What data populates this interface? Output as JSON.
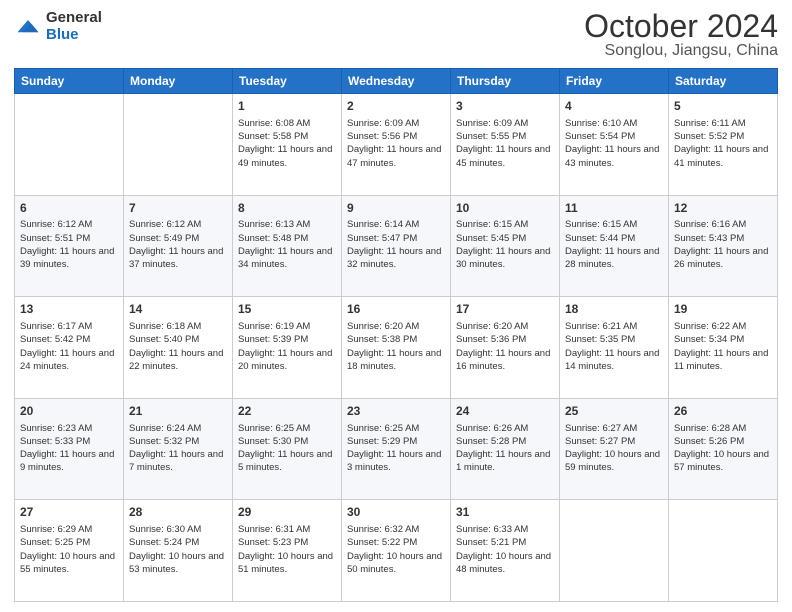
{
  "header": {
    "logo_general": "General",
    "logo_blue": "Blue",
    "month_title": "October 2024",
    "location": "Songlou, Jiangsu, China"
  },
  "weekdays": [
    "Sunday",
    "Monday",
    "Tuesday",
    "Wednesday",
    "Thursday",
    "Friday",
    "Saturday"
  ],
  "weeks": [
    [
      {
        "day": "",
        "sunrise": "",
        "sunset": "",
        "daylight": ""
      },
      {
        "day": "",
        "sunrise": "",
        "sunset": "",
        "daylight": ""
      },
      {
        "day": "1",
        "sunrise": "Sunrise: 6:08 AM",
        "sunset": "Sunset: 5:58 PM",
        "daylight": "Daylight: 11 hours and 49 minutes."
      },
      {
        "day": "2",
        "sunrise": "Sunrise: 6:09 AM",
        "sunset": "Sunset: 5:56 PM",
        "daylight": "Daylight: 11 hours and 47 minutes."
      },
      {
        "day": "3",
        "sunrise": "Sunrise: 6:09 AM",
        "sunset": "Sunset: 5:55 PM",
        "daylight": "Daylight: 11 hours and 45 minutes."
      },
      {
        "day": "4",
        "sunrise": "Sunrise: 6:10 AM",
        "sunset": "Sunset: 5:54 PM",
        "daylight": "Daylight: 11 hours and 43 minutes."
      },
      {
        "day": "5",
        "sunrise": "Sunrise: 6:11 AM",
        "sunset": "Sunset: 5:52 PM",
        "daylight": "Daylight: 11 hours and 41 minutes."
      }
    ],
    [
      {
        "day": "6",
        "sunrise": "Sunrise: 6:12 AM",
        "sunset": "Sunset: 5:51 PM",
        "daylight": "Daylight: 11 hours and 39 minutes."
      },
      {
        "day": "7",
        "sunrise": "Sunrise: 6:12 AM",
        "sunset": "Sunset: 5:49 PM",
        "daylight": "Daylight: 11 hours and 37 minutes."
      },
      {
        "day": "8",
        "sunrise": "Sunrise: 6:13 AM",
        "sunset": "Sunset: 5:48 PM",
        "daylight": "Daylight: 11 hours and 34 minutes."
      },
      {
        "day": "9",
        "sunrise": "Sunrise: 6:14 AM",
        "sunset": "Sunset: 5:47 PM",
        "daylight": "Daylight: 11 hours and 32 minutes."
      },
      {
        "day": "10",
        "sunrise": "Sunrise: 6:15 AM",
        "sunset": "Sunset: 5:45 PM",
        "daylight": "Daylight: 11 hours and 30 minutes."
      },
      {
        "day": "11",
        "sunrise": "Sunrise: 6:15 AM",
        "sunset": "Sunset: 5:44 PM",
        "daylight": "Daylight: 11 hours and 28 minutes."
      },
      {
        "day": "12",
        "sunrise": "Sunrise: 6:16 AM",
        "sunset": "Sunset: 5:43 PM",
        "daylight": "Daylight: 11 hours and 26 minutes."
      }
    ],
    [
      {
        "day": "13",
        "sunrise": "Sunrise: 6:17 AM",
        "sunset": "Sunset: 5:42 PM",
        "daylight": "Daylight: 11 hours and 24 minutes."
      },
      {
        "day": "14",
        "sunrise": "Sunrise: 6:18 AM",
        "sunset": "Sunset: 5:40 PM",
        "daylight": "Daylight: 11 hours and 22 minutes."
      },
      {
        "day": "15",
        "sunrise": "Sunrise: 6:19 AM",
        "sunset": "Sunset: 5:39 PM",
        "daylight": "Daylight: 11 hours and 20 minutes."
      },
      {
        "day": "16",
        "sunrise": "Sunrise: 6:20 AM",
        "sunset": "Sunset: 5:38 PM",
        "daylight": "Daylight: 11 hours and 18 minutes."
      },
      {
        "day": "17",
        "sunrise": "Sunrise: 6:20 AM",
        "sunset": "Sunset: 5:36 PM",
        "daylight": "Daylight: 11 hours and 16 minutes."
      },
      {
        "day": "18",
        "sunrise": "Sunrise: 6:21 AM",
        "sunset": "Sunset: 5:35 PM",
        "daylight": "Daylight: 11 hours and 14 minutes."
      },
      {
        "day": "19",
        "sunrise": "Sunrise: 6:22 AM",
        "sunset": "Sunset: 5:34 PM",
        "daylight": "Daylight: 11 hours and 11 minutes."
      }
    ],
    [
      {
        "day": "20",
        "sunrise": "Sunrise: 6:23 AM",
        "sunset": "Sunset: 5:33 PM",
        "daylight": "Daylight: 11 hours and 9 minutes."
      },
      {
        "day": "21",
        "sunrise": "Sunrise: 6:24 AM",
        "sunset": "Sunset: 5:32 PM",
        "daylight": "Daylight: 11 hours and 7 minutes."
      },
      {
        "day": "22",
        "sunrise": "Sunrise: 6:25 AM",
        "sunset": "Sunset: 5:30 PM",
        "daylight": "Daylight: 11 hours and 5 minutes."
      },
      {
        "day": "23",
        "sunrise": "Sunrise: 6:25 AM",
        "sunset": "Sunset: 5:29 PM",
        "daylight": "Daylight: 11 hours and 3 minutes."
      },
      {
        "day": "24",
        "sunrise": "Sunrise: 6:26 AM",
        "sunset": "Sunset: 5:28 PM",
        "daylight": "Daylight: 11 hours and 1 minute."
      },
      {
        "day": "25",
        "sunrise": "Sunrise: 6:27 AM",
        "sunset": "Sunset: 5:27 PM",
        "daylight": "Daylight: 10 hours and 59 minutes."
      },
      {
        "day": "26",
        "sunrise": "Sunrise: 6:28 AM",
        "sunset": "Sunset: 5:26 PM",
        "daylight": "Daylight: 10 hours and 57 minutes."
      }
    ],
    [
      {
        "day": "27",
        "sunrise": "Sunrise: 6:29 AM",
        "sunset": "Sunset: 5:25 PM",
        "daylight": "Daylight: 10 hours and 55 minutes."
      },
      {
        "day": "28",
        "sunrise": "Sunrise: 6:30 AM",
        "sunset": "Sunset: 5:24 PM",
        "daylight": "Daylight: 10 hours and 53 minutes."
      },
      {
        "day": "29",
        "sunrise": "Sunrise: 6:31 AM",
        "sunset": "Sunset: 5:23 PM",
        "daylight": "Daylight: 10 hours and 51 minutes."
      },
      {
        "day": "30",
        "sunrise": "Sunrise: 6:32 AM",
        "sunset": "Sunset: 5:22 PM",
        "daylight": "Daylight: 10 hours and 50 minutes."
      },
      {
        "day": "31",
        "sunrise": "Sunrise: 6:33 AM",
        "sunset": "Sunset: 5:21 PM",
        "daylight": "Daylight: 10 hours and 48 minutes."
      },
      {
        "day": "",
        "sunrise": "",
        "sunset": "",
        "daylight": ""
      },
      {
        "day": "",
        "sunrise": "",
        "sunset": "",
        "daylight": ""
      }
    ]
  ]
}
